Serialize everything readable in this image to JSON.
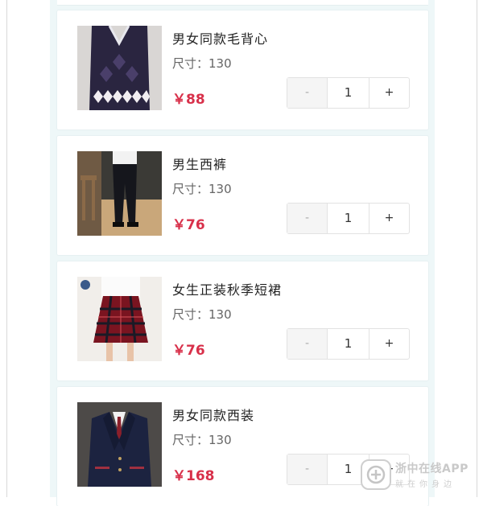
{
  "products": [
    {
      "name": "男女同款毛背心",
      "size": "尺寸：130",
      "price": "￥88",
      "qty": "1",
      "image": "navy-argyle-vest"
    },
    {
      "name": "男生西裤",
      "size": "尺寸：130",
      "price": "￥76",
      "qty": "1",
      "image": "boy-black-trousers"
    },
    {
      "name": "女生正装秋季短裙",
      "size": "尺寸：130",
      "price": "￥76",
      "qty": "1",
      "image": "red-plaid-skirt"
    },
    {
      "name": "男女同款西装",
      "size": "尺寸：130",
      "price": "￥168",
      "qty": "1",
      "image": "navy-blazer"
    }
  ],
  "stepper": {
    "minus": "-",
    "plus": "+"
  },
  "watermark": {
    "title": "浙中在线APP",
    "subtitle": "就在你身边"
  },
  "colors": {
    "price": "#d8304a",
    "background_strip": "#eef7f8",
    "card": "#ffffff"
  }
}
